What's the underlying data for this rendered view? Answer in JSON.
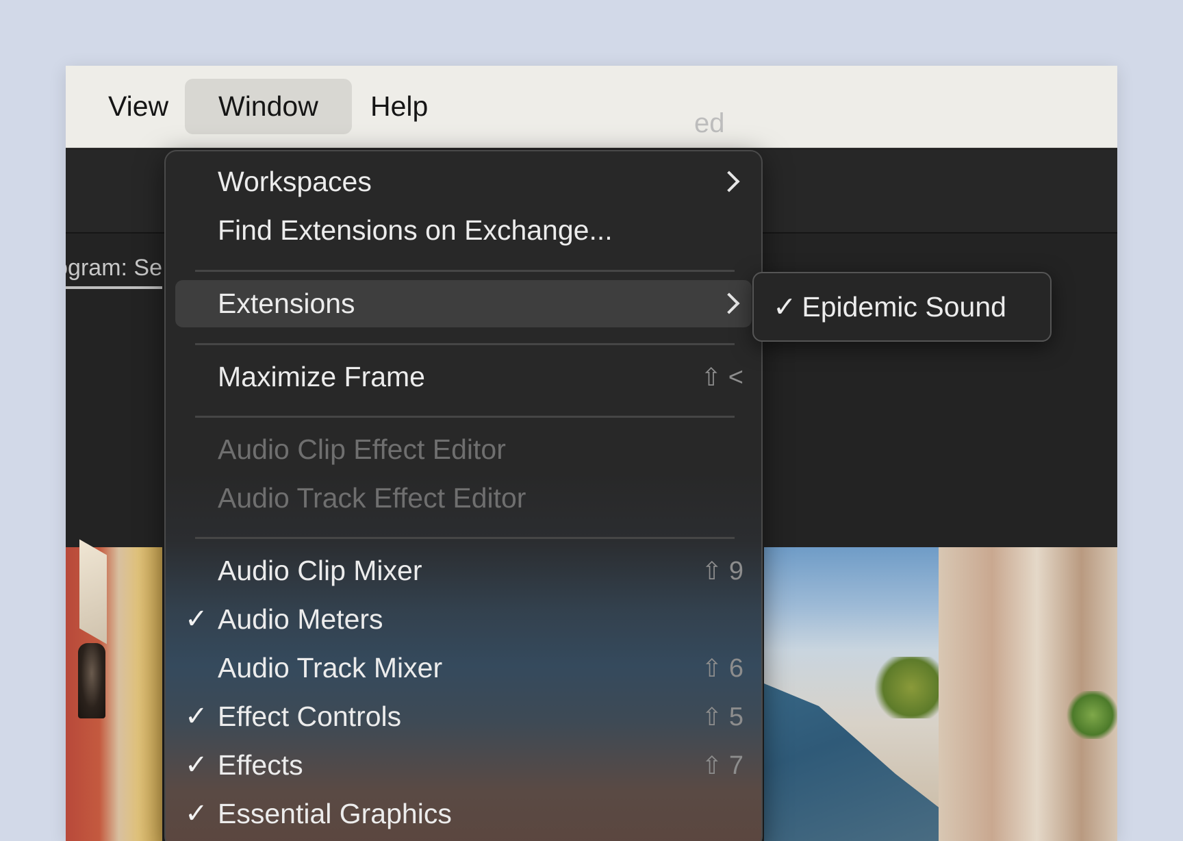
{
  "menubar": {
    "items": [
      {
        "label": "View"
      },
      {
        "label": "Window"
      },
      {
        "label": "Help"
      }
    ]
  },
  "background": {
    "header_text": "ed",
    "panel_tab_label": "Program: Se"
  },
  "window_menu": {
    "items": [
      {
        "label": "Workspaces",
        "has_submenu": true
      },
      {
        "label": "Find Extensions on Exchange..."
      },
      {
        "label": "Extensions",
        "has_submenu": true,
        "highlighted": true
      },
      {
        "label": "Maximize Frame",
        "shortcut_symbol": "⇧",
        "shortcut_key": "<"
      },
      {
        "label": "Audio Clip Effect Editor",
        "disabled": true
      },
      {
        "label": "Audio Track Effect Editor",
        "disabled": true
      },
      {
        "label": "Audio Clip Mixer",
        "shortcut_symbol": "⇧",
        "shortcut_key": "9"
      },
      {
        "label": "Audio Meters",
        "checked": true,
        "check": "✓"
      },
      {
        "label": "Audio Track Mixer",
        "shortcut_symbol": "⇧",
        "shortcut_key": "6"
      },
      {
        "label": "Effect Controls",
        "checked": true,
        "check": "✓",
        "shortcut_symbol": "⇧",
        "shortcut_key": "5"
      },
      {
        "label": "Effects",
        "checked": true,
        "check": "✓",
        "shortcut_symbol": "⇧",
        "shortcut_key": "7"
      },
      {
        "label": "Essential Graphics",
        "checked": true,
        "check": "✓"
      }
    ]
  },
  "extensions_submenu": {
    "items": [
      {
        "label": "Epidemic Sound",
        "checked": true,
        "check": "✓"
      }
    ]
  }
}
